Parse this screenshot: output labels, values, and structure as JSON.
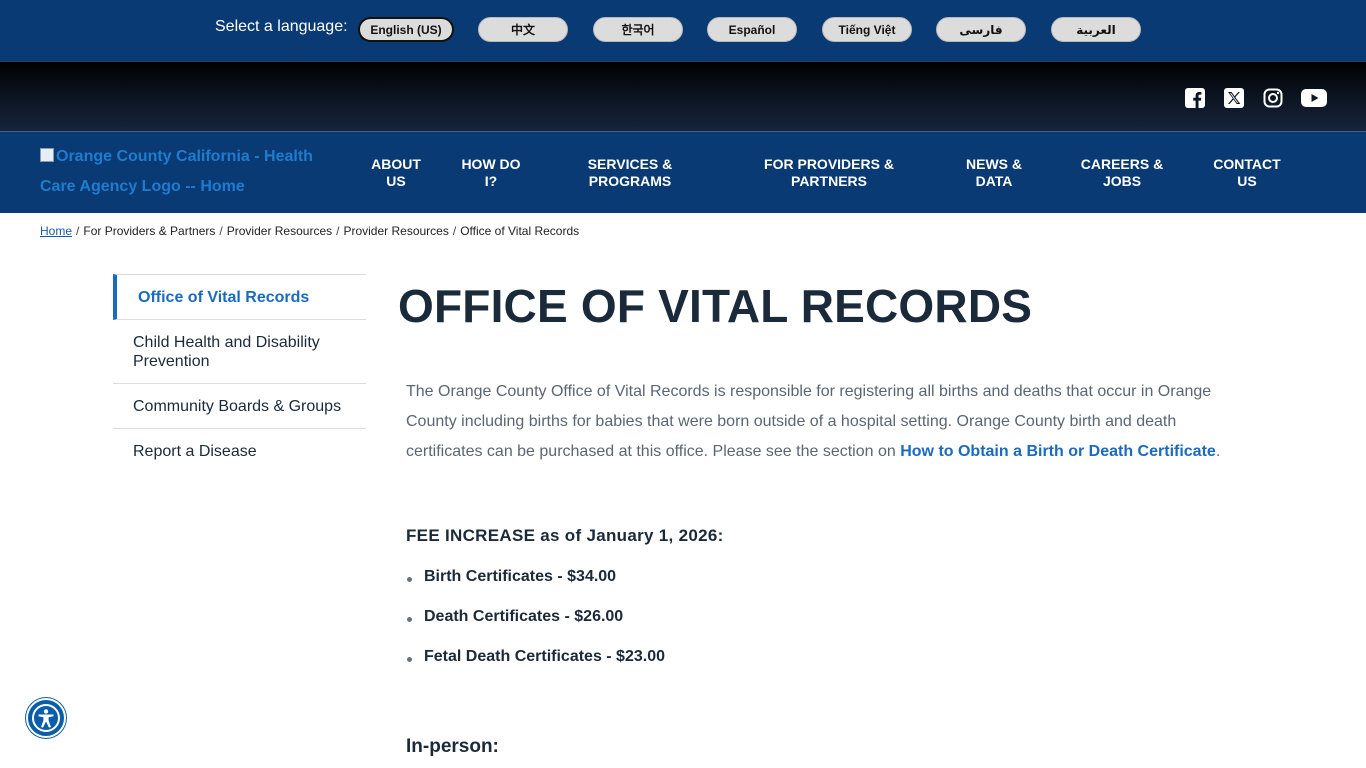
{
  "language_bar": {
    "label": "Select a language:",
    "languages": [
      "English (US)",
      "中文",
      "한국어",
      "Español",
      "Tiếng Việt",
      "فارسی",
      "العربية"
    ]
  },
  "social": {
    "icons": [
      "facebook-icon",
      "x-icon",
      "instagram-icon",
      "youtube-icon"
    ]
  },
  "header": {
    "logo_alt": "Orange County California - Health Care Agency Logo -- Home",
    "nav": [
      {
        "line1": "ABOUT",
        "line2": "US"
      },
      {
        "line1": "HOW DO",
        "line2": "I?"
      },
      {
        "line1": "SERVICES &",
        "line2": "PROGRAMS"
      },
      {
        "line1": "FOR PROVIDERS &",
        "line2": "PARTNERS"
      },
      {
        "line1": "NEWS &",
        "line2": "DATA"
      },
      {
        "line1": "CAREERS &",
        "line2": "JOBS"
      },
      {
        "line1": "CONTACT",
        "line2": "US"
      }
    ]
  },
  "breadcrumb": {
    "home": "Home",
    "items": [
      "For Providers & Partners",
      "Provider Resources",
      "Provider Resources",
      "Office of Vital Records"
    ]
  },
  "sidebar": {
    "items": [
      "Office of Vital Records",
      "Child Health and Disability Prevention",
      "Community Boards & Groups",
      "Report a Disease"
    ]
  },
  "main": {
    "title": "OFFICE OF VITAL RECORDS",
    "intro_text": "The Orange County Office of Vital Records is responsible for registering all births and deaths that occur in Orange County including births for babies that were born outside of a hospital setting.  Orange County birth and death certificates can be purchased at this office.  Please see the section on ",
    "intro_link": "How to Obtain a Birth or Death Certificate",
    "intro_end": ".",
    "fee_heading": "FEE INCREASE as of January 1, 2026:",
    "fees": [
      "Birth Certificates - $34.00",
      "Death Certificates - $26.00",
      "Fetal Death Certificates - $23.00"
    ],
    "inperson_heading": "In-person:"
  },
  "colors": {
    "brand_blue": "#0a3a73",
    "link_blue": "#1a6bbf",
    "text_dark": "#1b2a3a"
  }
}
